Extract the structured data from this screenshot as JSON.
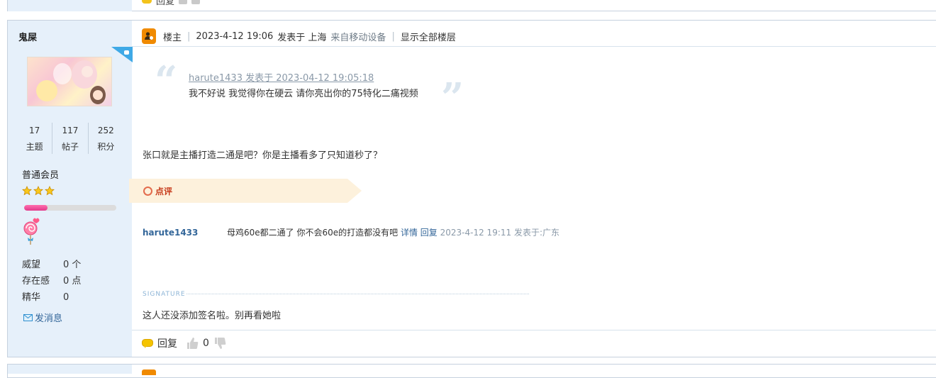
{
  "previous_post": {
    "reply_label": "回复"
  },
  "author": {
    "name": "鬼屎",
    "stats": [
      {
        "value": "17",
        "label": "主题"
      },
      {
        "value": "117",
        "label": "帖子"
      },
      {
        "value": "252",
        "label": "积分"
      }
    ],
    "group": "普通会员",
    "star_count": 3,
    "level_progress": 0.25,
    "profile": [
      {
        "key": "威望",
        "value": "0 个"
      },
      {
        "key": "存在感",
        "value": "0 点"
      },
      {
        "key": "精华",
        "value": "0"
      }
    ],
    "send_message": "发消息"
  },
  "post": {
    "op_label": "楼主",
    "datetime": "2023-4-12 19:06",
    "posted_in": "发表于 上海",
    "device": "来自移动设备",
    "show_all_floors": "显示全部楼层",
    "quote": {
      "meta": "harute1433 发表于 2023-04-12 19:05:18",
      "text": "我不好说 我觉得你在硬云 请你亮出你的75特化二痛视频"
    },
    "message": "张口就是主播打造二通是吧？你是主播看多了只知道秒了？",
    "comments_label": "点评",
    "comments": [
      {
        "user": "harute1433",
        "text": "母鸡60e都二通了 你不会60e的打造都没有吧",
        "detail": "详情",
        "reply": "回复",
        "time": "2023-4-12 19:11 发表于:广东"
      }
    ],
    "signature_label": "SIGNATURE",
    "signature": "这人还没添加签名啦。别再看她啦",
    "reply_label": "回复",
    "likes": "0"
  },
  "colors": {
    "accent": "#336699",
    "sidebar_bg": "#e6f0fa",
    "op_badge": "#f08a00",
    "comment_ribbon": "#fdf1dc",
    "comment_label": "#c73b1b"
  }
}
